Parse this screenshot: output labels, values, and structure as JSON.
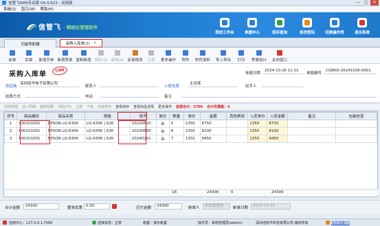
{
  "window": {
    "title": "信管飞RMS专业版 V9.4.623 - 试用版",
    "ctrl_min": "—",
    "ctrl_max": "□",
    "ctrl_close": "✕"
  },
  "menu": [
    {
      "label": "系统(S)"
    },
    {
      "label": "窗口(W)"
    },
    {
      "label": "帮助(H)"
    }
  ],
  "banner": {
    "brand": "信管飞",
    "slogan": "· 精细化管理软件",
    "buttons": [
      {
        "label": "我的工作台",
        "icon": "desk-icon",
        "color": "#2a7fd4"
      },
      {
        "label": "单据中心",
        "icon": "doc-icon",
        "color": "#2a7fd4"
      },
      {
        "label": "库存查询",
        "icon": "box-icon",
        "color": "#2fa34c"
      },
      {
        "label": "修改密码",
        "icon": "key-icon",
        "color": "#e28a1a"
      },
      {
        "label": "切换操作员",
        "icon": "user-icon",
        "color": "#2a7fd4"
      },
      {
        "label": "退出系统",
        "icon": "power-icon",
        "color": "#d13a2f"
      }
    ]
  },
  "tabs": {
    "nav": "功能导航器",
    "active": "采购入库单(1)",
    "close": "✕"
  },
  "toolbar": [
    {
      "label": "前单",
      "icon": "prev-icon",
      "color": "#3c7bd0",
      "enabled": true
    },
    {
      "label": "后单",
      "icon": "next-icon",
      "color": "#3c7bd0",
      "enabled": true
    },
    {
      "label": "新增开单",
      "icon": "new-doc-icon",
      "color": "#3c7bd0",
      "enabled": true
    },
    {
      "label": "新增草单",
      "icon": "draft-icon",
      "color": "#3c7bd0",
      "enabled": true
    },
    {
      "label": "复制新增",
      "icon": "copy-icon",
      "color": "#3c7bd0",
      "enabled": true
    },
    {
      "label": "保存(S)",
      "icon": "save-icon",
      "color": "#bbb",
      "enabled": false
    },
    {
      "label": "审核(A)",
      "icon": "audit-icon",
      "color": "#bbb",
      "enabled": false
    },
    {
      "label": "反审修改",
      "icon": "unaudit-icon",
      "color": "#d07a2a",
      "enabled": true
    },
    {
      "label": "引用",
      "icon": "quote-icon",
      "color": "#bbb",
      "enabled": false
    },
    {
      "label": "更多操作",
      "icon": "more-icon",
      "color": "#3c7bd0",
      "enabled": true
    },
    {
      "label": "附件",
      "icon": "attach-icon",
      "color": "#3c7bd0",
      "enabled": true
    },
    {
      "label": "附件资料",
      "icon": "files-icon",
      "color": "#3c7bd0",
      "enabled": true
    },
    {
      "label": "导入导出",
      "icon": "import-icon",
      "color": "#3c7bd0",
      "enabled": true
    },
    {
      "label": "打印",
      "icon": "print-icon",
      "color": "#3c7bd0",
      "enabled": true
    },
    {
      "label": "界面设计",
      "icon": "design-icon",
      "color": "#3c7bd0",
      "enabled": true
    },
    {
      "label": "关闭窗口",
      "icon": "close-window-icon",
      "color": "#d13a2f",
      "enabled": true
    }
  ],
  "form": {
    "title": "采购入库单",
    "stamp": "已审核",
    "date_label": "单据日期",
    "date": "2024-10-26 11:21",
    "no_label": "单据编号",
    "no": "CGRKD-20241026-0001",
    "supplier_label": "供应商",
    "supplier": "深圳佳华电子有限公司",
    "contact_label": "联系人",
    "warehouse_label": "入库仓库",
    "warehouse": "主仓库",
    "handler_label": "经手人",
    "settle_label": "结算方式",
    "phone_label": "电话",
    "remark_label": "备注"
  },
  "grid_toolbar": [
    {
      "label": "添加明细",
      "on": false
    },
    {
      "label": "插入明细",
      "on": false
    },
    {
      "label": "删除明细",
      "on": false
    },
    {
      "label": "扫码(F4)",
      "on": false
    },
    {
      "label": "上移",
      "on": false
    },
    {
      "label": "下移",
      "on": false
    },
    {
      "label": "快速排序",
      "on": false
    },
    {
      "label": "查看库存",
      "on": true
    },
    {
      "label": "查看商品详情",
      "on": true
    },
    {
      "label": "更多操作",
      "on": true
    }
  ],
  "grid_notice": {
    "text1": "底部合计：",
    "val1": "2700",
    "text2": "合计优惠额：",
    "val2": "0"
  },
  "columns": [
    "序号",
    "商品编码",
    "商品名称",
    "规格",
    "批号",
    "单位",
    "数量",
    "单价",
    "金额",
    "其他费用",
    "入库单价",
    "入库金额",
    "备注",
    "包装信息"
  ],
  "rows": [
    {
      "no": "1",
      "code": "100101001",
      "name": "EPSON LQ-630K",
      "spec": "LQ-630K | 62K",
      "batch": "20220610",
      "unit": "台",
      "qty": "5",
      "price": "1350",
      "amount": "6750",
      "other": "",
      "in_price": "1350",
      "in_amount": "6750",
      "remark": "",
      "pack": ""
    },
    {
      "no": "2",
      "code": "100101001",
      "name": "EPSON LQ-630K",
      "spec": "LQ-630K | 62K",
      "batch": "20230600",
      "unit": "台",
      "qty": "6",
      "price": "1350",
      "amount": "8100",
      "other": "",
      "in_price": "1350",
      "in_amount": "8100",
      "remark": "",
      "pack": ""
    },
    {
      "no": "3",
      "code": "100101001",
      "name": "EPSON LQ-630K",
      "spec": "LQ-630K | 62K",
      "batch": "20240101",
      "unit": "台",
      "qty": "7",
      "price": "1350",
      "amount": "9450",
      "other": "",
      "in_price": "1350",
      "in_amount": "9450",
      "remark": "",
      "pack": ""
    }
  ],
  "totals": {
    "qty": "18",
    "amount": "24300",
    "other": "0",
    "in_amount": "24300"
  },
  "footer": {
    "sum_label": "合计金额",
    "sum": "24300",
    "discount_label": "整单优惠",
    "discount": "0.00",
    "payable_label": "应付金额",
    "payable": "24300",
    "maker_label": "制单人",
    "maker": "系统管理员",
    "make_date_label": "制单日期",
    "make_date": "2024-10-26"
  },
  "status": {
    "server": "信用中心：127.0.0.1:7099",
    "conn": "连接状态：正常",
    "user": "帐套：演示帐套",
    "operator": "操作员：系统管理员(admin)",
    "company": "深圳佳软件科技有限公司 版权所有",
    "msg": "消息提醒(0)"
  }
}
